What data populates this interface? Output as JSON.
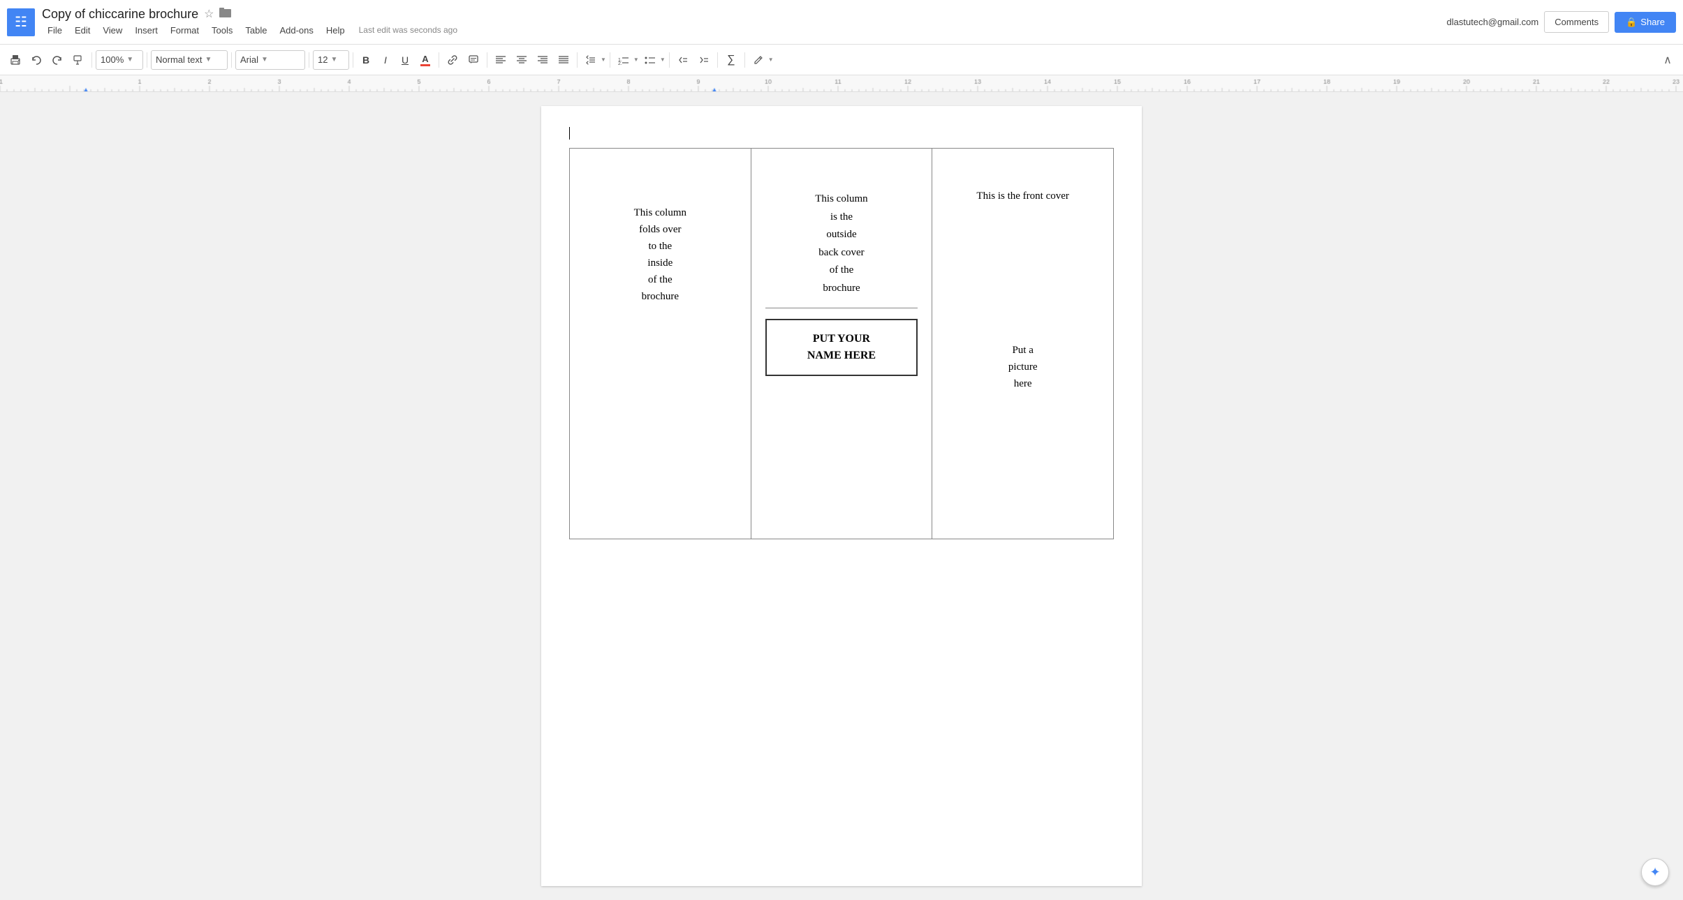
{
  "app": {
    "title": "Copy of chiccarine brochure",
    "star_label": "☆",
    "folder_label": "📁",
    "apps_icon": "☰"
  },
  "menu": {
    "items": [
      "File",
      "Edit",
      "View",
      "Insert",
      "Format",
      "Tools",
      "Table",
      "Add-ons",
      "Help"
    ],
    "last_edit": "Last edit was seconds ago"
  },
  "toolbar": {
    "print_icon": "🖨",
    "undo_icon": "↺",
    "redo_icon": "↻",
    "paint_icon": "🎨",
    "zoom": "100%",
    "style": "Normal text",
    "font": "Arial",
    "size": "12",
    "bold": "B",
    "italic": "I",
    "underline": "U",
    "text_color": "A",
    "link_icon": "🔗",
    "comment_icon": "💬",
    "align_left": "≡",
    "align_center": "≡",
    "align_right": "≡",
    "align_justify": "≡",
    "line_spacing": "↕",
    "numbered_list": "1.",
    "bullet_list": "•",
    "indent_less": "←",
    "indent_more": "→",
    "formula": "∑",
    "pen_icon": "✏",
    "expand_icon": "∧"
  },
  "user": {
    "email": "dlastutech@gmail.com"
  },
  "header_buttons": {
    "comments": "Comments",
    "share": "Share",
    "lock_icon": "🔒"
  },
  "brochure": {
    "col1_text": "This column\nfolds over\nto the\ninside\nof the\nbrochure",
    "col2_top_text": "This column\nis the\noutside\nback cover\nof the\nbrochure",
    "col2_name_line1": "PUT YOUR",
    "col2_name_line2": "NAME HERE",
    "col3_top_text": "This is the front cover",
    "col3_bottom_text": "Put a\npicture\nhere"
  },
  "smart_compose": {
    "icon": "✦"
  }
}
